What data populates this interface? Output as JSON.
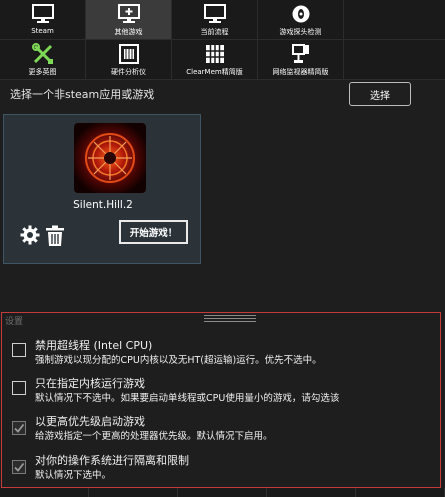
{
  "toolbar": {
    "row1": [
      {
        "label": "Steam",
        "icon": "monitor-icon"
      },
      {
        "label": "其他游戏",
        "icon": "monitor-plus-icon"
      },
      {
        "label": "当前流程",
        "icon": "monitor-icon"
      },
      {
        "label": "游戏探头检测",
        "icon": "eye-disc-icon"
      }
    ],
    "row2": [
      {
        "label": "更多英图",
        "icon": "tools-icon"
      },
      {
        "label": "硬件分析仪",
        "icon": "chip-icon"
      },
      {
        "label": "ClearMem精简版",
        "icon": "memory-grid-icon"
      },
      {
        "label": "网络监视器精简版",
        "icon": "network-icon"
      }
    ],
    "active": "其他游戏"
  },
  "select_prompt": "选择一个非steam应用或游戏",
  "select_button": "选择",
  "game": {
    "name": "Silent.Hill.2",
    "start_label": "开始游戏！"
  },
  "settings": {
    "title": "设置",
    "options": [
      {
        "title": "禁用超线程 (Intel CPU)",
        "desc": "强制游戏以现分配的CPU内核以及无HT(超运输)运行。优先不选中。",
        "checked": false
      },
      {
        "title": "只在指定内核运行游戏",
        "desc": "默认情况下不选中。如果要启动单线程或CPU使用量小的游戏，请勾选该",
        "checked": false
      },
      {
        "title": "以更高优先级启动游戏",
        "desc": "给游戏指定一个更高的处理器优先级。默认情况下启用。",
        "checked": true
      },
      {
        "title": "对你的操作系统进行隔离和限制",
        "desc": "默认情况下选中。",
        "checked": true
      }
    ]
  },
  "colors": {
    "panel_border": "#c53a3a",
    "card_background": "#2b3339",
    "background": "#1e1e1e"
  }
}
